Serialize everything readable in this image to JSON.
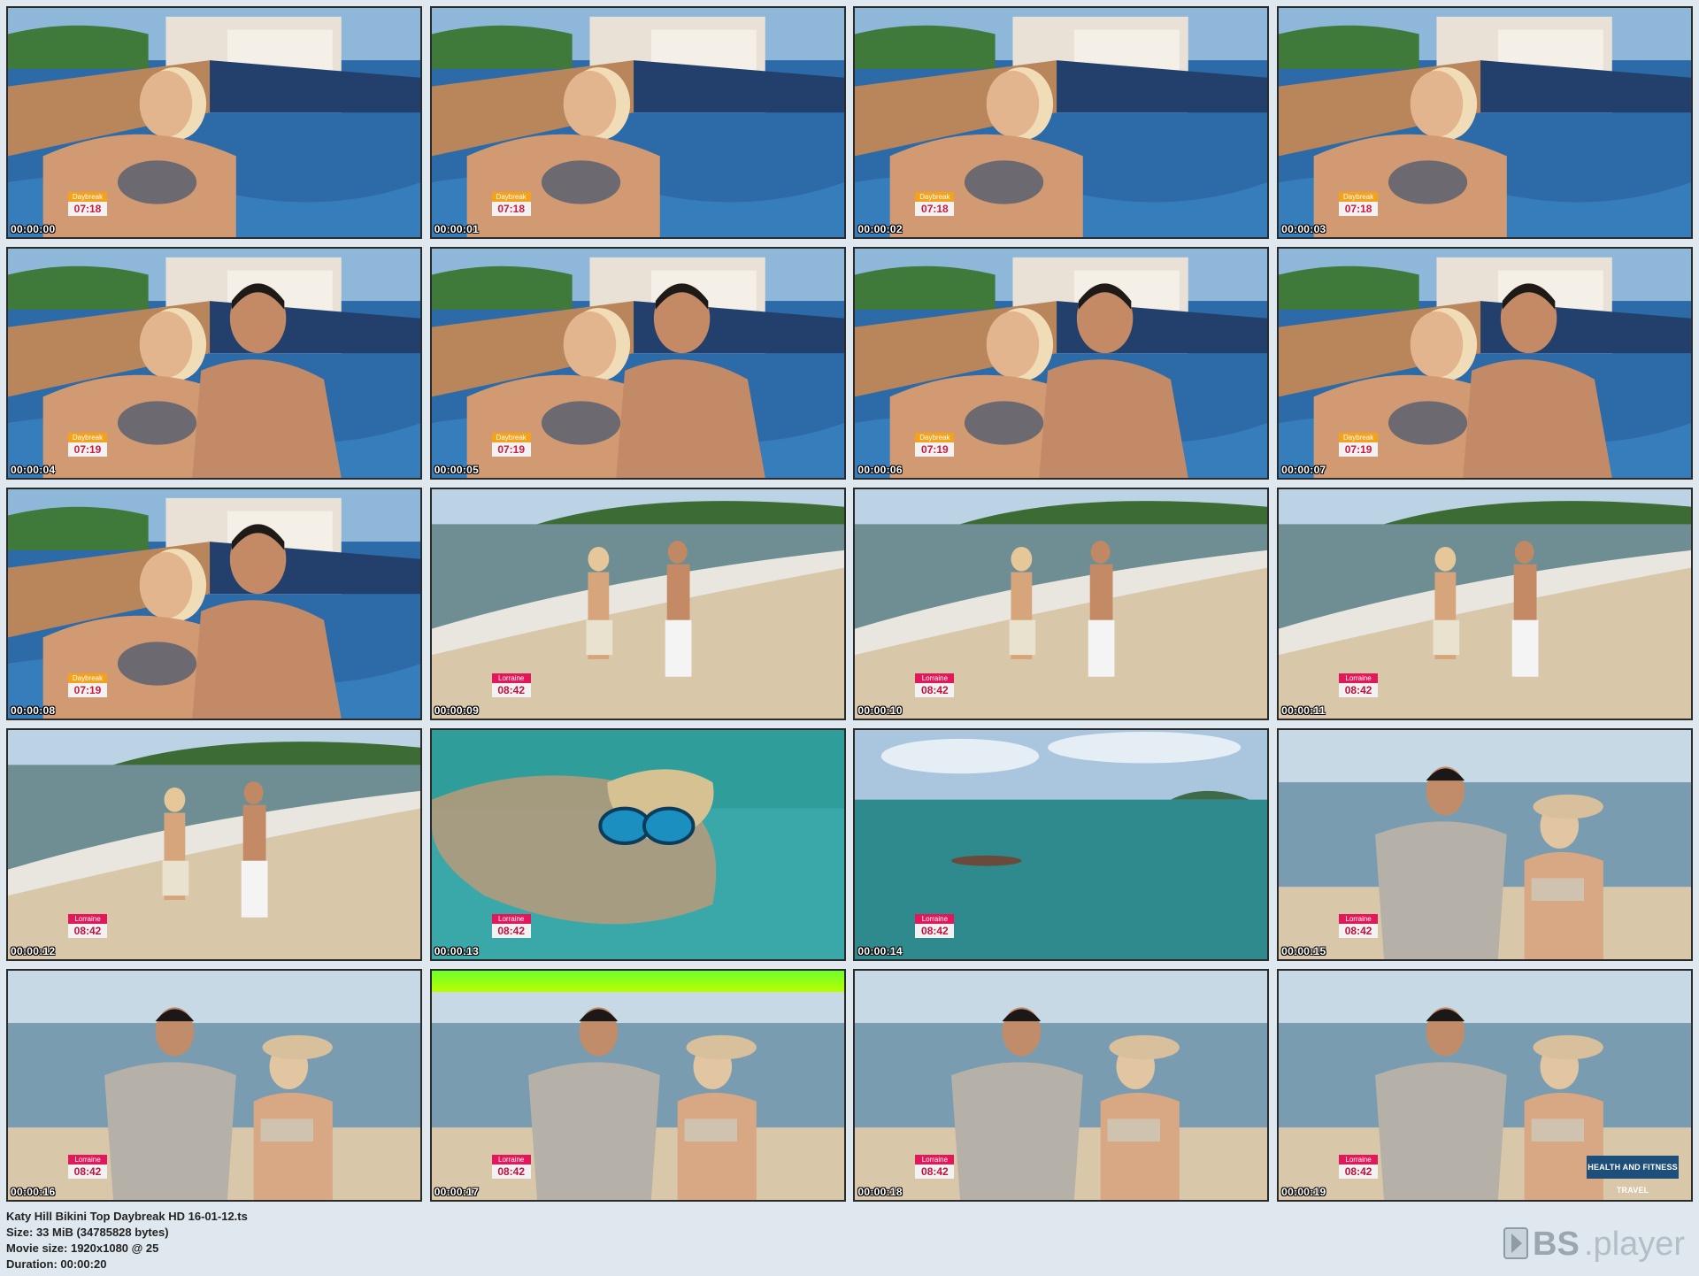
{
  "frames": [
    {
      "time": "00:00:00",
      "bug": {
        "name": "Daybreak",
        "time": "07:18",
        "style": "orange"
      },
      "scene": "pool-woman"
    },
    {
      "time": "00:00:01",
      "bug": {
        "name": "Daybreak",
        "time": "07:18",
        "style": "orange"
      },
      "scene": "pool-woman"
    },
    {
      "time": "00:00:02",
      "bug": {
        "name": "Daybreak",
        "time": "07:18",
        "style": "orange"
      },
      "scene": "pool-woman"
    },
    {
      "time": "00:00:03",
      "bug": {
        "name": "Daybreak",
        "time": "07:18",
        "style": "orange"
      },
      "scene": "pool-woman"
    },
    {
      "time": "00:00:04",
      "bug": {
        "name": "Daybreak",
        "time": "07:19",
        "style": "orange"
      },
      "scene": "pool-couple"
    },
    {
      "time": "00:00:05",
      "bug": {
        "name": "Daybreak",
        "time": "07:19",
        "style": "orange"
      },
      "scene": "pool-couple"
    },
    {
      "time": "00:00:06",
      "bug": {
        "name": "Daybreak",
        "time": "07:19",
        "style": "orange"
      },
      "scene": "pool-couple"
    },
    {
      "time": "00:00:07",
      "bug": {
        "name": "Daybreak",
        "time": "07:19",
        "style": "orange"
      },
      "scene": "pool-couple"
    },
    {
      "time": "00:00:08",
      "bug": {
        "name": "Daybreak",
        "time": "07:19",
        "style": "orange"
      },
      "scene": "pool-couple"
    },
    {
      "time": "00:00:09",
      "bug": {
        "name": "Lorraine",
        "time": "08:42",
        "style": "pink"
      },
      "scene": "beach-walk"
    },
    {
      "time": "00:00:10",
      "bug": {
        "name": "Lorraine",
        "time": "08:42",
        "style": "pink"
      },
      "scene": "beach-walk"
    },
    {
      "time": "00:00:11",
      "bug": {
        "name": "Lorraine",
        "time": "08:42",
        "style": "pink"
      },
      "scene": "beach-walk"
    },
    {
      "time": "00:00:12",
      "bug": {
        "name": "Lorraine",
        "time": "08:42",
        "style": "pink"
      },
      "scene": "beach-walk"
    },
    {
      "time": "00:00:13",
      "bug": {
        "name": "Lorraine",
        "time": "08:42",
        "style": "pink"
      },
      "scene": "underwater"
    },
    {
      "time": "00:00:14",
      "bug": {
        "name": "Lorraine",
        "time": "08:42",
        "style": "pink"
      },
      "scene": "open-sea"
    },
    {
      "time": "00:00:15",
      "bug": {
        "name": "Lorraine",
        "time": "08:42",
        "style": "pink"
      },
      "scene": "shore-couple"
    },
    {
      "time": "00:00:16",
      "bug": {
        "name": "Lorraine",
        "time": "08:42",
        "style": "pink"
      },
      "scene": "shore-couple"
    },
    {
      "time": "00:00:17",
      "bug": {
        "name": "Lorraine",
        "time": "08:42",
        "style": "pink"
      },
      "scene": "shore-couple",
      "greenbar": true
    },
    {
      "time": "00:00:18",
      "bug": {
        "name": "Lorraine",
        "time": "08:42",
        "style": "pink"
      },
      "scene": "shore-couple"
    },
    {
      "time": "00:00:19",
      "bug": {
        "name": "Lorraine",
        "time": "08:42",
        "style": "pink"
      },
      "scene": "shore-couple",
      "logo": "HEALTH AND FITNESS TRAVEL"
    }
  ],
  "info": {
    "filename": "Katy Hill Bikini Top Daybreak HD 16-01-12.ts",
    "size": "Size: 33 MiB (34785828 bytes)",
    "movie_size": "Movie size: 1920x1080 @ 25",
    "duration": "Duration: 00:00:20"
  },
  "brand": {
    "name": "BS.player",
    "icon": "bs-player-logo"
  },
  "colors": {
    "background": "#dfe8ee",
    "daybreak_orange": "#f3a21c",
    "lorraine_pink": "#e2185b",
    "pool_water": "#2c6aa8",
    "sea_turquoise": "#3aa8a8",
    "sand": "#d9c7aa",
    "sky": "#bcd3e6",
    "brand_grey": "#9aa7b1"
  }
}
